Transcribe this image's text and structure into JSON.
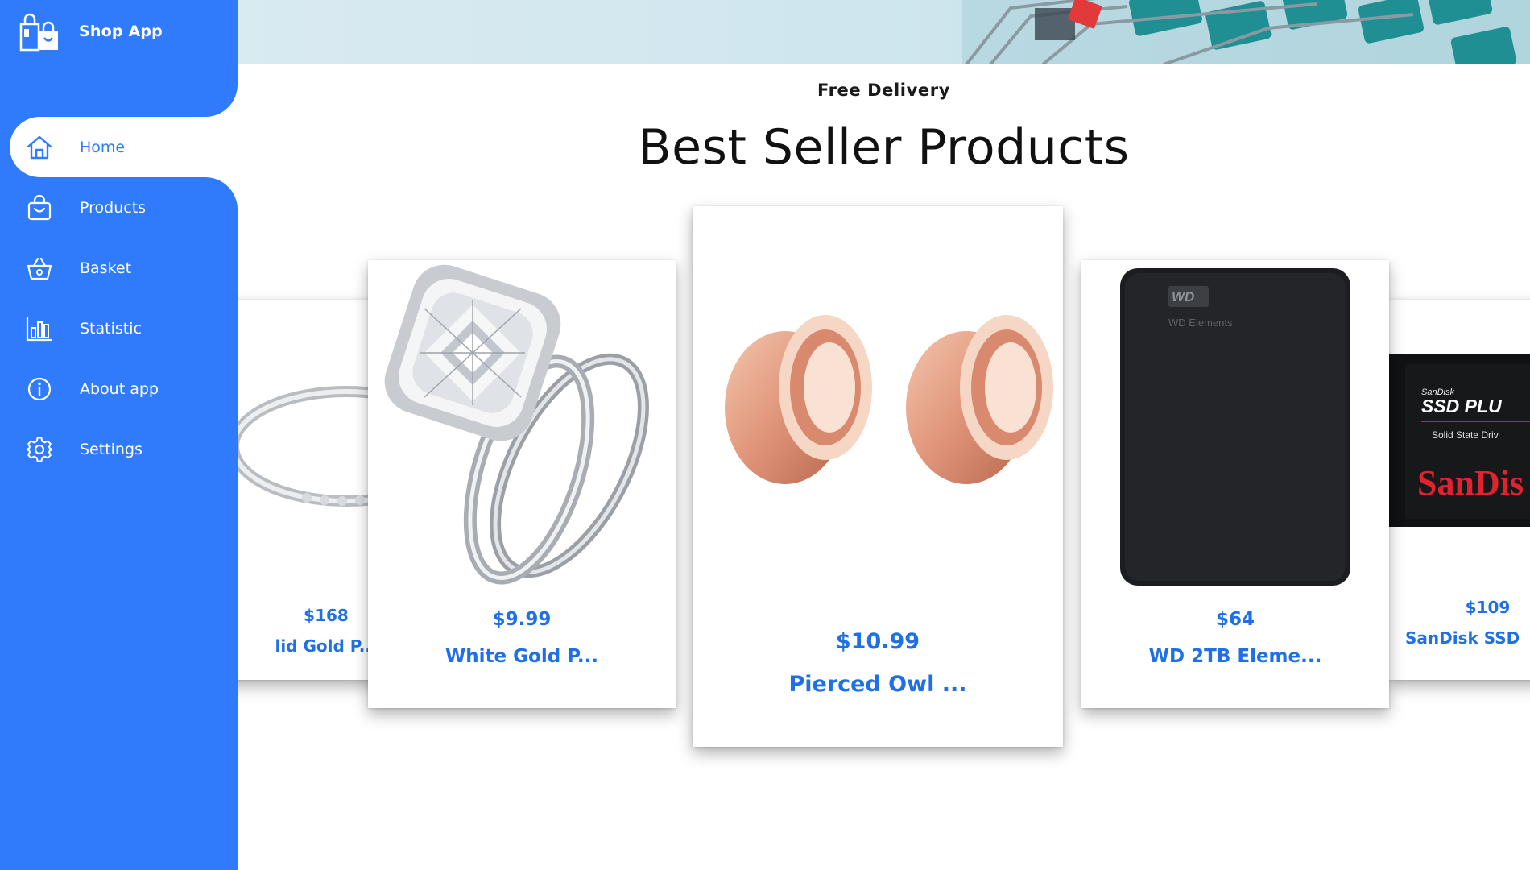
{
  "app": {
    "name": "Shop App",
    "logo_icon": "shopping-bag-icon"
  },
  "sidebar": {
    "items": [
      {
        "label": "Home",
        "icon": "home-icon",
        "active": true
      },
      {
        "label": "Products",
        "icon": "shopping-bag-icon",
        "active": false
      },
      {
        "label": "Basket",
        "icon": "basket-icon",
        "active": false
      },
      {
        "label": "Statistic",
        "icon": "bar-chart-icon",
        "active": false
      },
      {
        "label": "About app",
        "icon": "info-icon",
        "active": false
      },
      {
        "label": "Settings",
        "icon": "gear-icon",
        "active": false
      }
    ]
  },
  "main": {
    "subtitle": "Free Delivery",
    "title": "Best Seller Products",
    "products": [
      {
        "price": "$168",
        "name": "lid Gold P..."
      },
      {
        "price": "$9.99",
        "name": "White Gold P..."
      },
      {
        "price": "$10.99",
        "name": "Pierced Owl ..."
      },
      {
        "price": "$64",
        "name": "WD 2TB Eleme..."
      },
      {
        "price": "$109",
        "name": "SanDisk SSD"
      }
    ]
  },
  "product_image_text": {
    "wd_label": "WD Elements",
    "sandisk_brand": "SanDisk",
    "sandisk_model": "SSD PLU",
    "sandisk_sub": "Solid State Driv",
    "sandisk_logo": "SanDis"
  },
  "colors": {
    "sidebar": "#2f7bfb",
    "accent_text": "#1f6fe6",
    "background": "#ffffff"
  }
}
